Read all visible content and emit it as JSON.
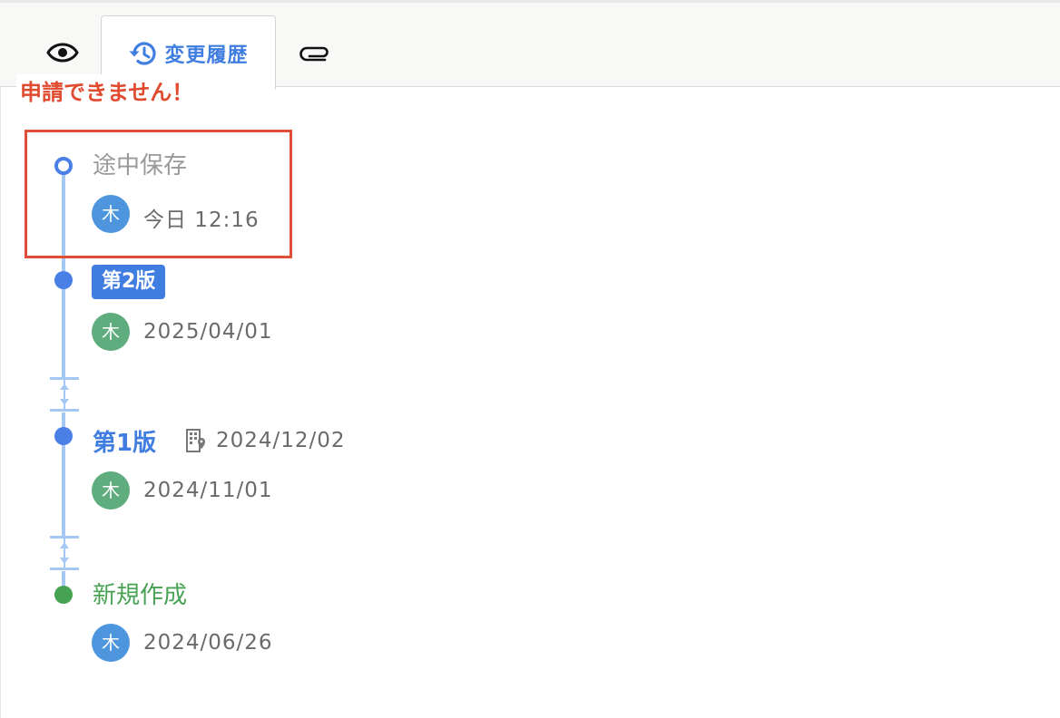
{
  "tabs": {
    "preview_icon": "eye-icon",
    "history_label": "変更履歴",
    "history_icon": "history-icon",
    "attach_icon": "paperclip-icon",
    "active": "history"
  },
  "warning": "申請できません！",
  "timeline": {
    "draft": {
      "title": "途中保存",
      "avatar": "木",
      "date": "今日 12:16"
    },
    "v2": {
      "badge": "第2版",
      "avatar": "木",
      "date": "2025/04/01"
    },
    "v1": {
      "title": "第1版",
      "publish_date": "2024/12/02",
      "publish_icon": "office-building-icon",
      "avatar": "木",
      "date": "2024/11/01"
    },
    "new": {
      "title": "新規作成",
      "avatar": "木",
      "date": "2024/06/26"
    }
  },
  "colors": {
    "accent_blue": "#3f7de0",
    "green": "#48a253",
    "warning_red": "#e04a2e",
    "timeline_line": "#a5c7f3",
    "avatar_blue": "#4d96de",
    "avatar_green": "#5fad7e"
  }
}
